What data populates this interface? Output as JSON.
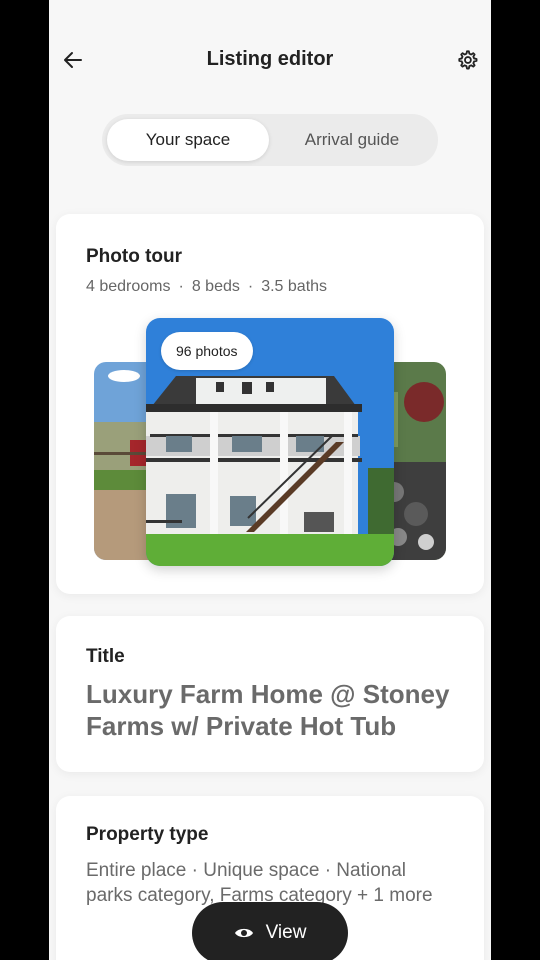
{
  "header": {
    "title": "Listing editor",
    "back_icon": "arrow-left-icon",
    "settings_icon": "gear-icon"
  },
  "tabs": [
    {
      "label": "Your space",
      "active": true
    },
    {
      "label": "Arrival guide",
      "active": false
    }
  ],
  "photo_tour": {
    "heading": "Photo tour",
    "bedrooms": "4 bedrooms",
    "beds": "8 beds",
    "baths": "3.5 baths",
    "photos_badge": "96 photos"
  },
  "title_card": {
    "heading": "Title",
    "value": "Luxury Farm Home @ Stoney Farms w/ Private Hot Tub"
  },
  "property_type": {
    "heading": "Property type",
    "value": "Entire place · Unique space · National parks category, Farms category + 1 more"
  },
  "view_button": {
    "label": "View",
    "icon": "eye-icon"
  }
}
